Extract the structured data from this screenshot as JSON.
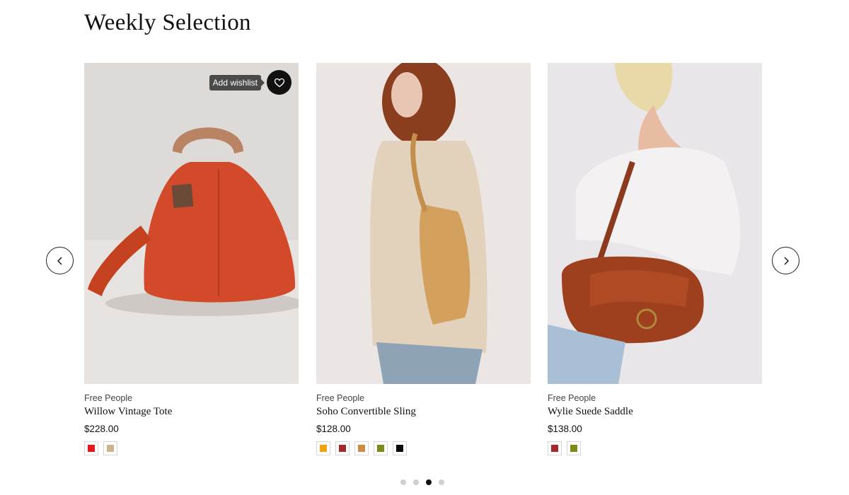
{
  "section": {
    "title": "Weekly Selection"
  },
  "wishlist": {
    "tooltip": "Add wishlist",
    "icon": "heart-icon"
  },
  "navigation": {
    "prev_icon": "chevron-left-icon",
    "next_icon": "chevron-right-icon"
  },
  "products": [
    {
      "brand": "Free People",
      "name": "Willow Vintage Tote",
      "price": "$228.00",
      "swatches": [
        "#e8161b",
        "#cdb28c"
      ]
    },
    {
      "brand": "Free People",
      "name": "Soho Convertible Sling",
      "price": "$128.00",
      "swatches": [
        "#f2a20a",
        "#a8282a",
        "#cf8a45",
        "#7d8b14",
        "#0a0a0a"
      ]
    },
    {
      "brand": "Free People",
      "name": "Wylie Suede Saddle",
      "price": "$138.00",
      "swatches": [
        "#a8282a",
        "#7d8b14"
      ]
    }
  ],
  "pagination": {
    "total": 4,
    "active": 3
  }
}
